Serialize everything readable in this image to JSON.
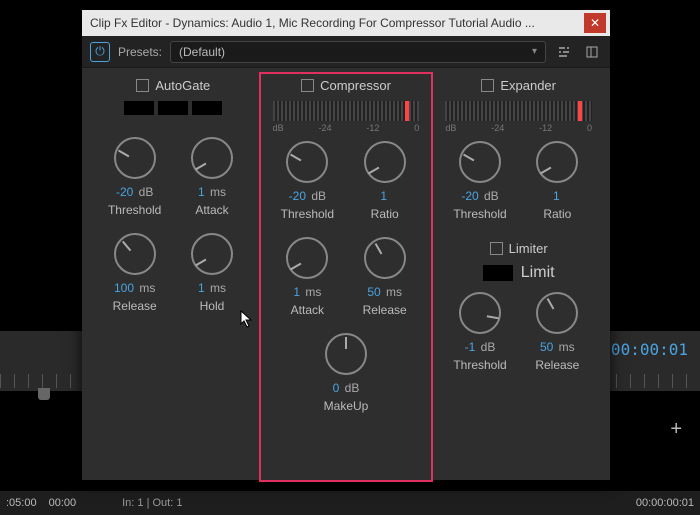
{
  "background": {
    "timecode": "00:00:00:01",
    "bottom_tc_left": ":05:00",
    "bottom_tc_left2": "00:00",
    "inout": "In: 1 | Out: 1",
    "bottom_tc_right": "00:00:00:01"
  },
  "panel": {
    "title": "Clip Fx Editor - Dynamics: Audio 1, Mic Recording For Compressor Tutorial Audio ...",
    "presets_label": "Presets:",
    "preset_value": "(Default)"
  },
  "autogate": {
    "title": "AutoGate",
    "knobs": [
      {
        "value": "-20",
        "unit": "dB",
        "label": "Threshold",
        "rot": -60
      },
      {
        "value": "1",
        "unit": "ms",
        "label": "Attack",
        "rot": -120
      },
      {
        "value": "100",
        "unit": "ms",
        "label": "Release",
        "rot": -40
      },
      {
        "value": "1",
        "unit": "ms",
        "label": "Hold",
        "rot": -120
      }
    ]
  },
  "compressor": {
    "title": "Compressor",
    "ticks": [
      "dB",
      "-24",
      "-12",
      "0"
    ],
    "knobs": [
      {
        "value": "-20",
        "unit": "dB",
        "label": "Threshold",
        "rot": -60
      },
      {
        "value": "1",
        "unit": "",
        "label": "Ratio",
        "rot": -120
      },
      {
        "value": "1",
        "unit": "ms",
        "label": "Attack",
        "rot": -120
      },
      {
        "value": "50",
        "unit": "ms",
        "label": "Release",
        "rot": -30
      },
      {
        "value": "0",
        "unit": "dB",
        "label": "MakeUp",
        "rot": 0
      }
    ]
  },
  "expander": {
    "title": "Expander",
    "ticks": [
      "dB",
      "-24",
      "-12",
      "0"
    ],
    "knobs": [
      {
        "value": "-20",
        "unit": "dB",
        "label": "Threshold",
        "rot": -60
      },
      {
        "value": "1",
        "unit": "",
        "label": "Ratio",
        "rot": -120
      }
    ]
  },
  "limiter": {
    "title": "Limiter",
    "limit_label": "Limit",
    "knobs": [
      {
        "value": "-1",
        "unit": "dB",
        "label": "Threshold",
        "rot": 100
      },
      {
        "value": "50",
        "unit": "ms",
        "label": "Release",
        "rot": -30
      }
    ]
  }
}
